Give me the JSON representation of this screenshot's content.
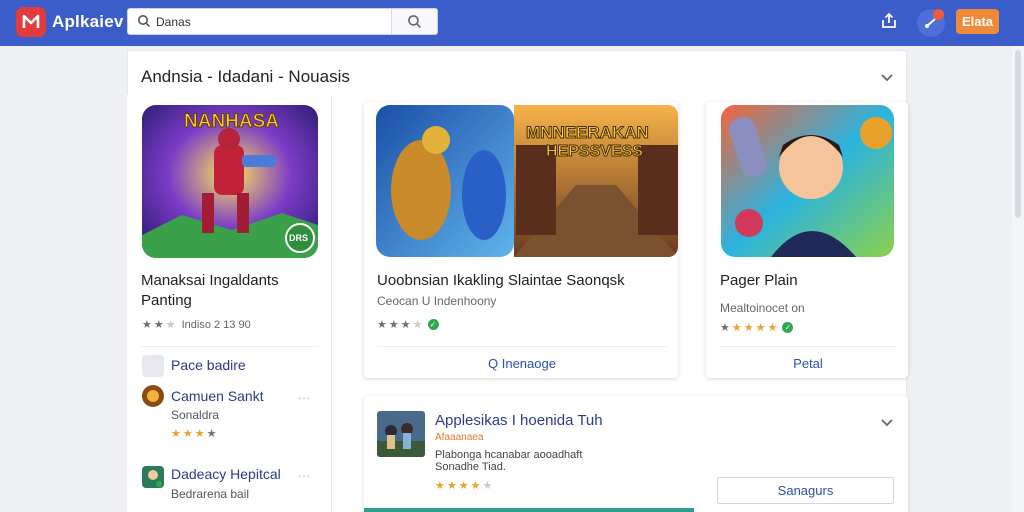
{
  "header": {
    "app_title": "Aplkaiev",
    "search_value": "Danas",
    "cta_label": "Elata",
    "icons": [
      "logo-icon",
      "search-icon",
      "upload-icon",
      "notifications-icon"
    ]
  },
  "section": {
    "title": "Andnsia - Idadani - Nouasis"
  },
  "cards": [
    {
      "art_text": "NANHASA",
      "art_badge": "DRS",
      "title": "Manaksai Ingaldants Panting",
      "rating_text": "Indiso 2 13 90"
    },
    {
      "art_text": "MNNEERAKAN",
      "art_text2": "HEPSSVESS",
      "title": "Uoobnsian Ikakling Slaintae Saonqsk",
      "subtitle": "Ceocan U Indenhoony",
      "action": "Q Inenaoge"
    },
    {
      "title": "Pager Plain",
      "subtitle": "Mealtoinocet on",
      "action": "Petal"
    }
  ],
  "left_list": [
    {
      "title": "Pace badire",
      "subtitle": ""
    },
    {
      "title": "Camuen Sankt",
      "subtitle": "Sonaldra",
      "more": "..."
    },
    {
      "title": "Dadeacy Hepitcal",
      "subtitle": "Bedrarena bail",
      "more": "..."
    }
  ],
  "promo": {
    "title": "Applesikas I hoenida Tuh",
    "tag": "Afaaanaea",
    "desc_line1": "Plabonga hcanabar aooadhaft",
    "desc_line2": "Sonadhe Tiad.",
    "button": "Sanagurs"
  },
  "colors": {
    "header_bg": "#3a5dc9",
    "logo_red": "#e23b3b",
    "cta_orange": "#ef8a3a",
    "link_blue": "#2a3b8f",
    "verified_green": "#2fa84f"
  }
}
